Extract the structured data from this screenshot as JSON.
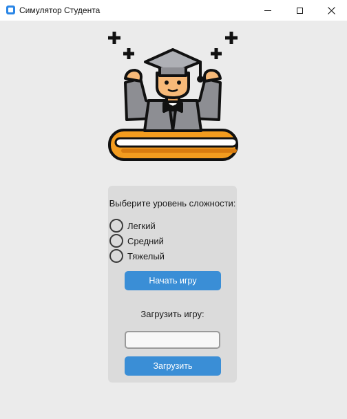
{
  "window": {
    "title": "Симулятор Студента"
  },
  "illustration": {
    "icon": "student-graduate-flexing-on-books-icon",
    "colors": {
      "outline": "#111111",
      "gown": "#8d8e93",
      "skin": "#f7b978",
      "cap": "#aeb0b5",
      "book": "#f39c1f"
    }
  },
  "panel": {
    "difficulty_label": "Выберите уровень сложности:",
    "difficulty_options": [
      "Легкий",
      "Средний",
      "Тяжелый"
    ],
    "start_button": "Начать игру",
    "load_label": "Загрузить игру:",
    "load_input": {
      "value": "",
      "placeholder": ""
    },
    "load_button": "Загрузить"
  },
  "colors": {
    "background": "#ebebeb",
    "panel": "#dbdbdb",
    "accent": "#3a8ed6"
  }
}
